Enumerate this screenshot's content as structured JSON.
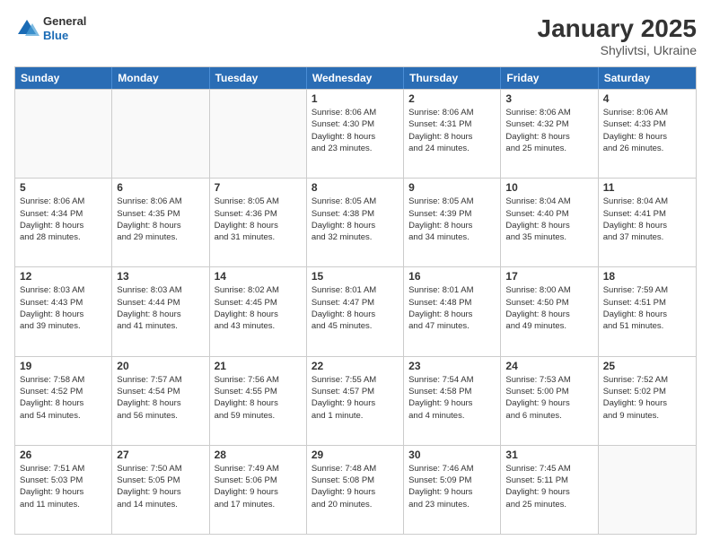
{
  "header": {
    "logo": {
      "general": "General",
      "blue": "Blue"
    },
    "title": "January 2025",
    "subtitle": "Shylivtsi, Ukraine"
  },
  "weekdays": [
    "Sunday",
    "Monday",
    "Tuesday",
    "Wednesday",
    "Thursday",
    "Friday",
    "Saturday"
  ],
  "rows": [
    [
      {
        "day": "",
        "info": ""
      },
      {
        "day": "",
        "info": ""
      },
      {
        "day": "",
        "info": ""
      },
      {
        "day": "1",
        "info": "Sunrise: 8:06 AM\nSunset: 4:30 PM\nDaylight: 8 hours\nand 23 minutes."
      },
      {
        "day": "2",
        "info": "Sunrise: 8:06 AM\nSunset: 4:31 PM\nDaylight: 8 hours\nand 24 minutes."
      },
      {
        "day": "3",
        "info": "Sunrise: 8:06 AM\nSunset: 4:32 PM\nDaylight: 8 hours\nand 25 minutes."
      },
      {
        "day": "4",
        "info": "Sunrise: 8:06 AM\nSunset: 4:33 PM\nDaylight: 8 hours\nand 26 minutes."
      }
    ],
    [
      {
        "day": "5",
        "info": "Sunrise: 8:06 AM\nSunset: 4:34 PM\nDaylight: 8 hours\nand 28 minutes."
      },
      {
        "day": "6",
        "info": "Sunrise: 8:06 AM\nSunset: 4:35 PM\nDaylight: 8 hours\nand 29 minutes."
      },
      {
        "day": "7",
        "info": "Sunrise: 8:05 AM\nSunset: 4:36 PM\nDaylight: 8 hours\nand 31 minutes."
      },
      {
        "day": "8",
        "info": "Sunrise: 8:05 AM\nSunset: 4:38 PM\nDaylight: 8 hours\nand 32 minutes."
      },
      {
        "day": "9",
        "info": "Sunrise: 8:05 AM\nSunset: 4:39 PM\nDaylight: 8 hours\nand 34 minutes."
      },
      {
        "day": "10",
        "info": "Sunrise: 8:04 AM\nSunset: 4:40 PM\nDaylight: 8 hours\nand 35 minutes."
      },
      {
        "day": "11",
        "info": "Sunrise: 8:04 AM\nSunset: 4:41 PM\nDaylight: 8 hours\nand 37 minutes."
      }
    ],
    [
      {
        "day": "12",
        "info": "Sunrise: 8:03 AM\nSunset: 4:43 PM\nDaylight: 8 hours\nand 39 minutes."
      },
      {
        "day": "13",
        "info": "Sunrise: 8:03 AM\nSunset: 4:44 PM\nDaylight: 8 hours\nand 41 minutes."
      },
      {
        "day": "14",
        "info": "Sunrise: 8:02 AM\nSunset: 4:45 PM\nDaylight: 8 hours\nand 43 minutes."
      },
      {
        "day": "15",
        "info": "Sunrise: 8:01 AM\nSunset: 4:47 PM\nDaylight: 8 hours\nand 45 minutes."
      },
      {
        "day": "16",
        "info": "Sunrise: 8:01 AM\nSunset: 4:48 PM\nDaylight: 8 hours\nand 47 minutes."
      },
      {
        "day": "17",
        "info": "Sunrise: 8:00 AM\nSunset: 4:50 PM\nDaylight: 8 hours\nand 49 minutes."
      },
      {
        "day": "18",
        "info": "Sunrise: 7:59 AM\nSunset: 4:51 PM\nDaylight: 8 hours\nand 51 minutes."
      }
    ],
    [
      {
        "day": "19",
        "info": "Sunrise: 7:58 AM\nSunset: 4:52 PM\nDaylight: 8 hours\nand 54 minutes."
      },
      {
        "day": "20",
        "info": "Sunrise: 7:57 AM\nSunset: 4:54 PM\nDaylight: 8 hours\nand 56 minutes."
      },
      {
        "day": "21",
        "info": "Sunrise: 7:56 AM\nSunset: 4:55 PM\nDaylight: 8 hours\nand 59 minutes."
      },
      {
        "day": "22",
        "info": "Sunrise: 7:55 AM\nSunset: 4:57 PM\nDaylight: 9 hours\nand 1 minute."
      },
      {
        "day": "23",
        "info": "Sunrise: 7:54 AM\nSunset: 4:58 PM\nDaylight: 9 hours\nand 4 minutes."
      },
      {
        "day": "24",
        "info": "Sunrise: 7:53 AM\nSunset: 5:00 PM\nDaylight: 9 hours\nand 6 minutes."
      },
      {
        "day": "25",
        "info": "Sunrise: 7:52 AM\nSunset: 5:02 PM\nDaylight: 9 hours\nand 9 minutes."
      }
    ],
    [
      {
        "day": "26",
        "info": "Sunrise: 7:51 AM\nSunset: 5:03 PM\nDaylight: 9 hours\nand 11 minutes."
      },
      {
        "day": "27",
        "info": "Sunrise: 7:50 AM\nSunset: 5:05 PM\nDaylight: 9 hours\nand 14 minutes."
      },
      {
        "day": "28",
        "info": "Sunrise: 7:49 AM\nSunset: 5:06 PM\nDaylight: 9 hours\nand 17 minutes."
      },
      {
        "day": "29",
        "info": "Sunrise: 7:48 AM\nSunset: 5:08 PM\nDaylight: 9 hours\nand 20 minutes."
      },
      {
        "day": "30",
        "info": "Sunrise: 7:46 AM\nSunset: 5:09 PM\nDaylight: 9 hours\nand 23 minutes."
      },
      {
        "day": "31",
        "info": "Sunrise: 7:45 AM\nSunset: 5:11 PM\nDaylight: 9 hours\nand 25 minutes."
      },
      {
        "day": "",
        "info": ""
      }
    ]
  ]
}
